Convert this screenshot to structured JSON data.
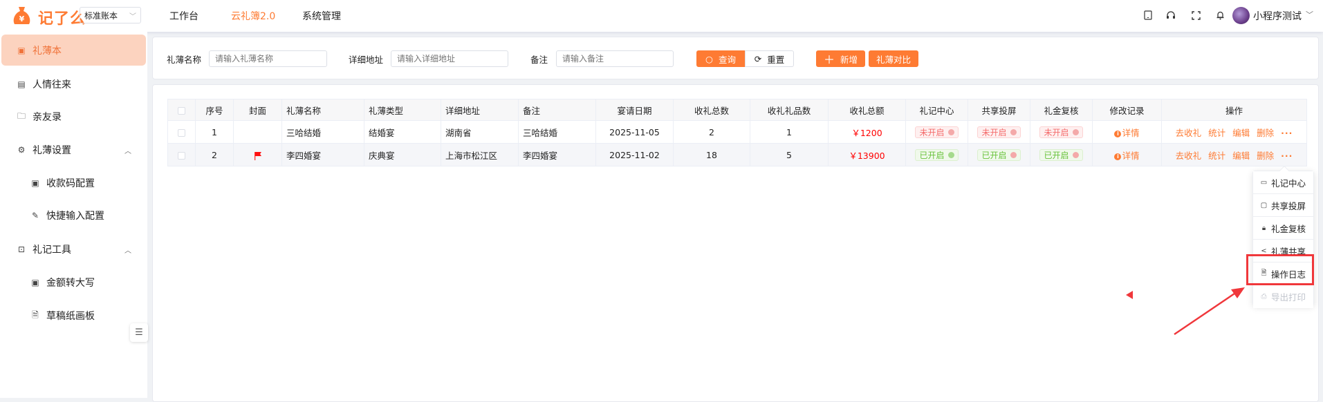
{
  "header": {
    "logo_text": "记了么",
    "account_select": "标准账本",
    "nav": [
      {
        "label": "工作台",
        "active": false
      },
      {
        "label": "云礼簿2.0",
        "active": true
      },
      {
        "label": "系统管理",
        "active": false
      }
    ],
    "icons": [
      "tablet-icon",
      "headset-icon",
      "fullscreen-icon",
      "bell-icon"
    ],
    "username": "小程序测试"
  },
  "sidebar": {
    "items": [
      {
        "label": "礼薄本",
        "icon": "book-icon",
        "active": true
      },
      {
        "label": "人情往来",
        "icon": "ledger-icon"
      },
      {
        "label": "亲友录",
        "icon": "folder-icon"
      },
      {
        "label": "礼薄设置",
        "icon": "gear-icon",
        "expanded": true
      },
      {
        "label": "收款码配置",
        "icon": "qrcode-icon",
        "sub": true
      },
      {
        "label": "快捷输入配置",
        "icon": "edit-icon",
        "sub": true
      },
      {
        "label": "礼记工具",
        "icon": "gift-icon",
        "expanded": true
      },
      {
        "label": "金额转大写",
        "icon": "money-icon",
        "sub": true
      },
      {
        "label": "草稿纸画板",
        "icon": "document-icon",
        "sub": true
      }
    ]
  },
  "search": {
    "name_label": "礼薄名称",
    "name_placeholder": "请输入礼薄名称",
    "address_label": "详细地址",
    "address_placeholder": "请输入详细地址",
    "note_label": "备注",
    "note_placeholder": "请输入备注",
    "query": "查询",
    "reset": "重置",
    "add": "新增",
    "compare": "礼薄对比"
  },
  "table": {
    "columns": [
      "",
      "序号",
      "封面",
      "礼薄名称",
      "礼薄类型",
      "详细地址",
      "备注",
      "宴请日期",
      "收礼总数",
      "收礼礼品数",
      "收礼总额",
      "礼记中心",
      "共享投屏",
      "礼金复核",
      "修改记录",
      "操作"
    ],
    "rows": [
      {
        "index": "1",
        "cover": "",
        "name": "三哈结婚",
        "type": "结婚宴",
        "address": "湖南省",
        "note": "三哈结婚",
        "date": "2025-11-05",
        "gift_count": "2",
        "item_count": "1",
        "amount": "￥1200",
        "center": "未开启",
        "screen": "未开启",
        "review": "未开启",
        "detail": "详情"
      },
      {
        "index": "2",
        "cover": "flag",
        "name": "李四婚宴",
        "type": "庆典宴",
        "address": "上海市松江区",
        "note": "李四婚宴",
        "date": "2025-11-02",
        "gift_count": "18",
        "item_count": "5",
        "amount": "￥13900",
        "center": "已开启",
        "screen": "已开启",
        "review": "已开启",
        "detail": "详情"
      }
    ],
    "actions": [
      "去收礼",
      "统计",
      "编辑",
      "删除",
      "···"
    ]
  },
  "dropdown": {
    "items": [
      {
        "label": "礼记中心",
        "icon": "presentation-icon"
      },
      {
        "label": "共享投屏",
        "icon": "monitor-icon"
      },
      {
        "label": "礼金复核",
        "icon": "lock-icon"
      },
      {
        "label": "礼薄共享",
        "icon": "share-icon"
      },
      {
        "label": "操作日志",
        "icon": "file-icon",
        "highlighted": true
      },
      {
        "label": "导出打印",
        "icon": "printer-icon",
        "disabled": true
      }
    ]
  },
  "colors": {
    "brand": "#fe7b33",
    "amount": "#ff0000",
    "annotation": "#f0373b"
  }
}
